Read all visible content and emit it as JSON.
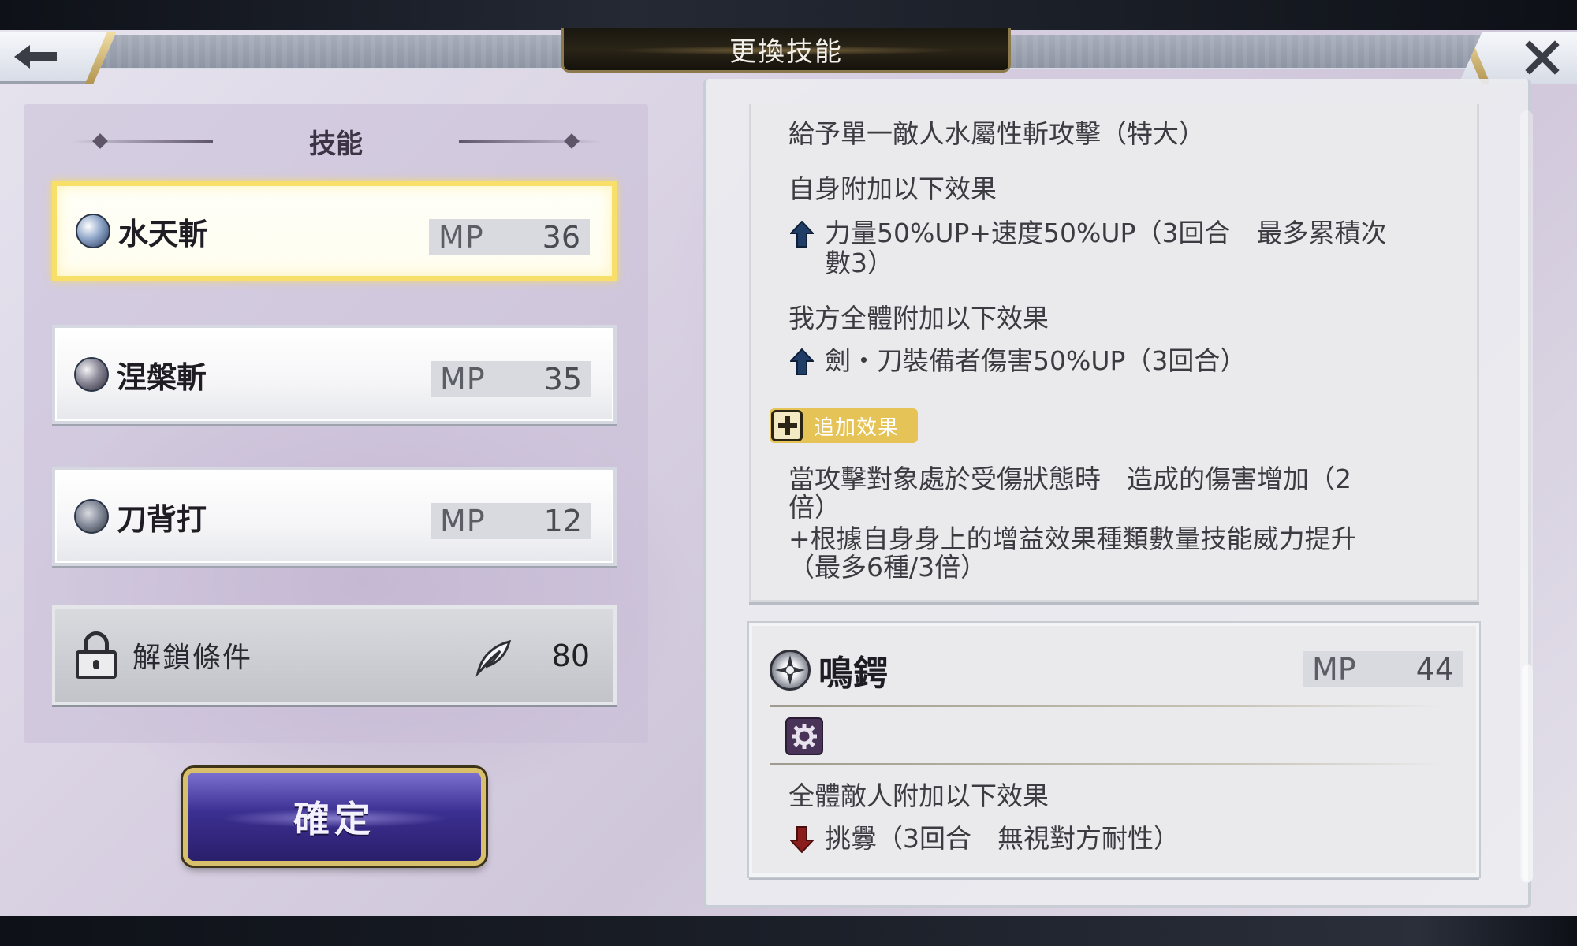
{
  "header": {
    "title": "更換技能"
  },
  "left": {
    "heading": "技能",
    "skills": [
      {
        "name": "水天斬",
        "mp_label": "MP",
        "mp": "36",
        "icon": "water-slash-icon",
        "selected": true
      },
      {
        "name": "涅槃斬",
        "mp_label": "MP",
        "mp": "35",
        "icon": "nirvana-slash-icon",
        "selected": false
      },
      {
        "name": "刀背打",
        "mp_label": "MP",
        "mp": "12",
        "icon": "blade-back-icon",
        "selected": false
      }
    ],
    "locked": {
      "label": "解鎖條件",
      "value": "80",
      "icon": "feather-icon"
    },
    "confirm_label": "確定"
  },
  "right": {
    "desc_lines": [
      "給予單一敵人水屬性斬攻擊（特大）",
      "自身附加以下效果",
      "力量50%UP+速度50%UP（3回合　最多累積次",
      "數3）",
      "我方全體附加以下效果",
      "劍・刀裝備者傷害50%UP（3回合）",
      "當攻擊對象處於受傷狀態時　造成的傷害增加（2",
      "倍）",
      "+根據自身身上的增益效果種類數量技能威力提升",
      "（最多6種/3倍）"
    ],
    "add_effect_label": "追加效果",
    "skill2": {
      "name": "鳴鍔",
      "mp_label": "MP",
      "mp": "44",
      "lines": [
        "全體敵人附加以下效果",
        "挑釁（3回合　無視對方耐性）"
      ]
    }
  },
  "colors": {
    "selected_border": "#f7df6a",
    "confirm_bg": "#3b2f91",
    "buff_arrow": "#1f3d66",
    "debuff_arrow": "#8a1c1c",
    "add_badge": "#e6c357"
  }
}
